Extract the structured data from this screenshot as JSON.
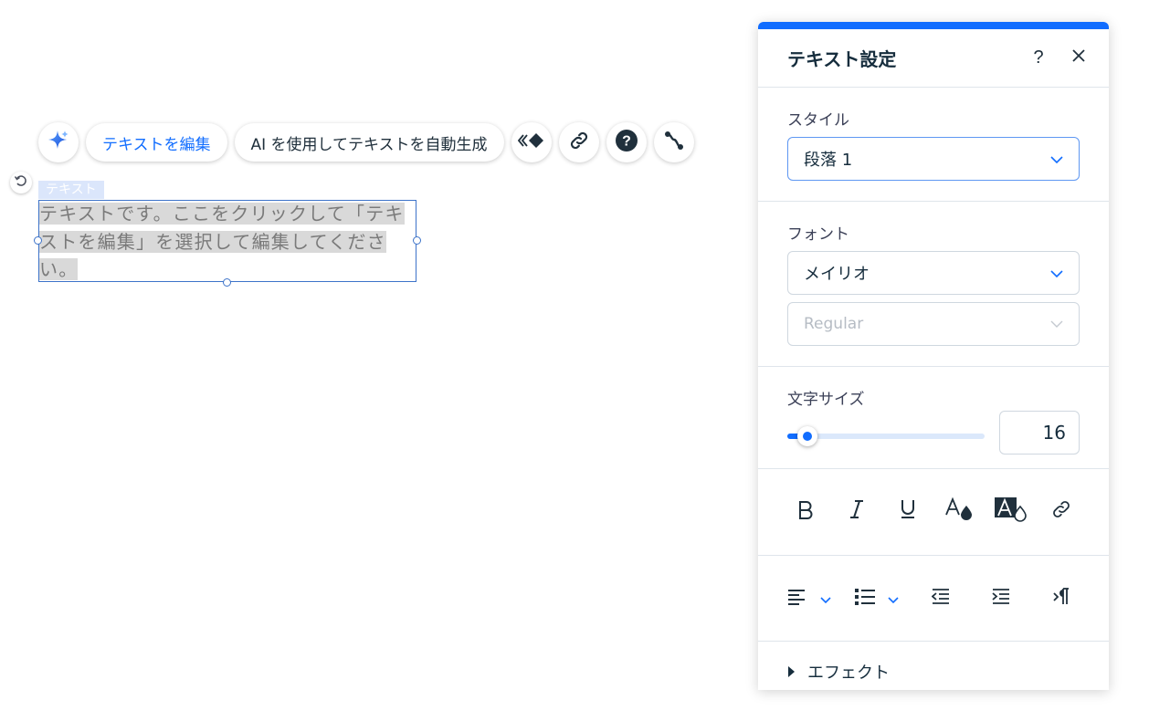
{
  "toolbar": {
    "ai_icon": "sparkle-icon",
    "edit_text_label": "テキストを編集",
    "ai_generate_label": "AI を使用してテキストを自動生成",
    "icons": [
      "animation-icon",
      "link-icon",
      "help-icon",
      "connect-icon"
    ]
  },
  "element": {
    "tag": "テキスト",
    "text_line1": "テキストです。ここをクリックして「テキ",
    "text_line2": "ストを編集」を選択して編集してくださ",
    "text_line3": "い。"
  },
  "panel": {
    "title": "テキスト設定",
    "help_label": "?",
    "style": {
      "label": "スタイル",
      "value": "段落 1"
    },
    "font": {
      "label": "フォント",
      "family": "メイリオ",
      "weight": "Regular"
    },
    "size": {
      "label": "文字サイズ",
      "value": "16",
      "slider_fraction": 0.1
    },
    "format_icons": [
      "bold-icon",
      "italic-icon",
      "underline-icon",
      "text-color-icon",
      "highlight-color-icon",
      "link-icon"
    ],
    "align_icons": [
      "align-left-icon",
      "bullet-list-icon",
      "indent-decrease-icon",
      "indent-increase-icon",
      "text-direction-icon"
    ],
    "effects_label": "エフェクト",
    "accent": "#116dff"
  }
}
